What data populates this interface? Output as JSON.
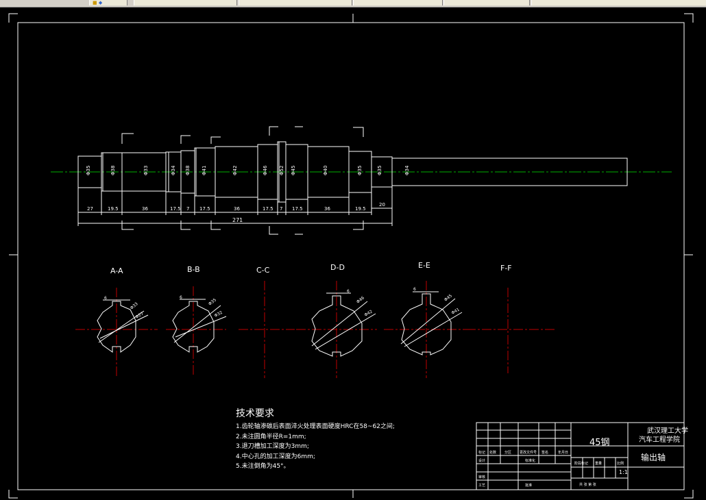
{
  "toolbar": {
    "tabs": [
      "",
      "",
      "",
      "",
      ""
    ]
  },
  "shaft": {
    "diameters": [
      "Φ35",
      "Φ38",
      "Φ33",
      "Φ34",
      "Φ38",
      "Φ41",
      "Φ42",
      "Φ46",
      "Φ52",
      "Φ45",
      "Φ40",
      "Φ35",
      "Φ35",
      "Φ34"
    ],
    "lengths": [
      "27",
      "19.5",
      "36",
      "17.5",
      "7",
      "17.5",
      "36",
      "17.5",
      "7",
      "17.5",
      "36",
      "19.5",
      "20"
    ],
    "overall": "271"
  },
  "sections": {
    "labels": [
      "A-A",
      "B-B",
      "C-C",
      "D-D",
      "E-E",
      "F-F"
    ],
    "key_widths": [
      "6",
      "6",
      "6",
      "6"
    ],
    "dims": [
      "Φ33",
      "Φ27",
      "Φ35",
      "Φ32",
      "Φ46",
      "Φ42",
      "Φ45",
      "Φ41"
    ]
  },
  "notes": {
    "title": "技术要求",
    "lines": [
      "1.齿轮轴渗碳后表面淬火处理表面硬度HRC在58~62之间;",
      "2.未注圆角半径R=1mm;",
      "3.退刀槽加工深度为3mm;",
      "4.中心孔的加工深度为6mm;",
      "5.未注倒角为45°。"
    ]
  },
  "title_block": {
    "material": "45钢",
    "part_name": "输出轴",
    "school": "武汉理工大学",
    "college": "汽车工程学院",
    "scale": "1:1",
    "label_design": "设计",
    "label_check": "审核",
    "label_process": "工艺",
    "label_approve": "批准",
    "label_standard": "标准化",
    "label_stage": "阶段标记",
    "label_weight": "重量",
    "label_ratio": "比例",
    "label_sheets": "共 张 第 张",
    "label_mark": "标记",
    "label_count": "处数",
    "label_zone": "分区",
    "label_doc": "更改文件号",
    "label_sign": "签名",
    "label_date": "年月日"
  }
}
